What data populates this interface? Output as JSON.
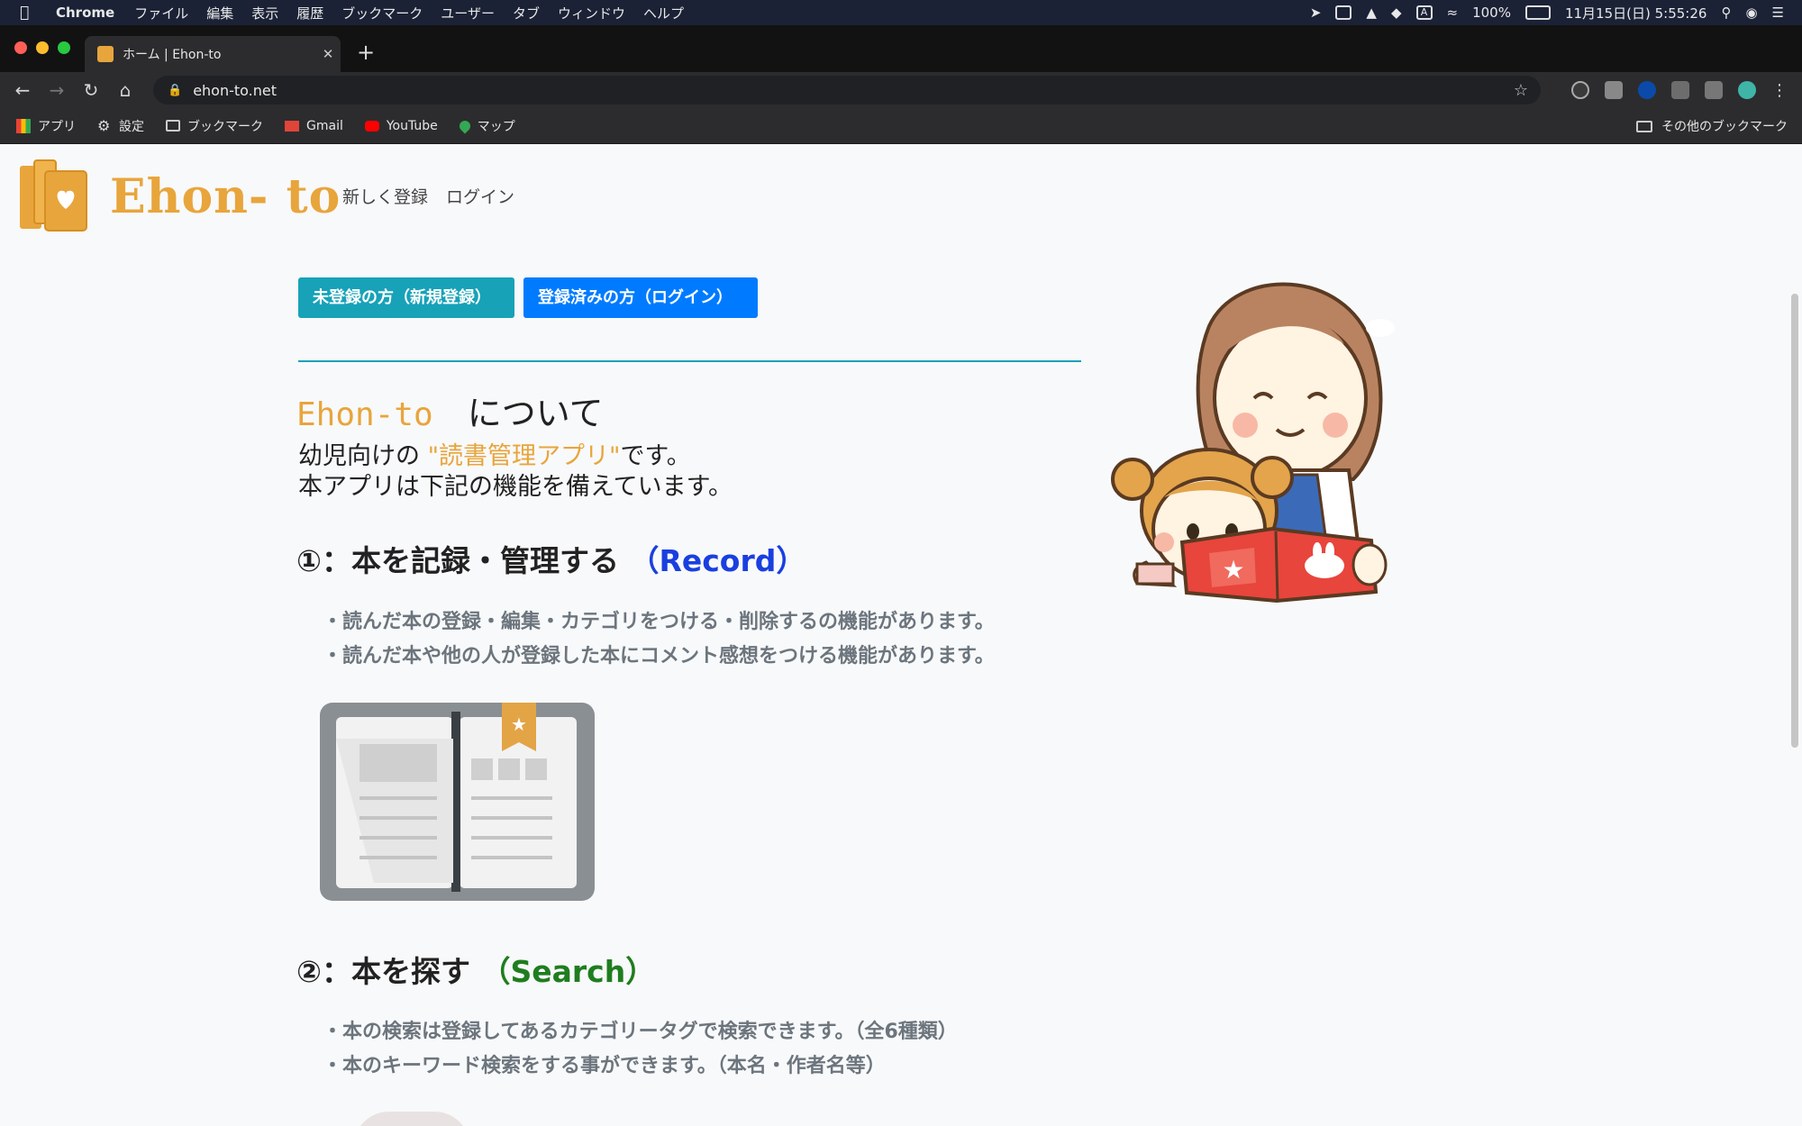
{
  "menubar": {
    "app": "Chrome",
    "items": [
      "ファイル",
      "編集",
      "表示",
      "履歴",
      "ブックマーク",
      "ユーザー",
      "タブ",
      "ウィンドウ",
      "ヘルプ"
    ],
    "battery": "100%",
    "datetime": "11月15日(日)  5:55:26"
  },
  "browser": {
    "tab_title": "ホーム | Ehon-to",
    "url": "ehon-to.net",
    "bookmarks": [
      "アプリ",
      "設定",
      "ブックマーク",
      "Gmail",
      "YouTube",
      "マップ"
    ],
    "other_bookmarks": "その他のブックマーク"
  },
  "header": {
    "logo": "Ehon- to",
    "nav": [
      "新しく登録",
      "ログイン"
    ]
  },
  "buttons": {
    "register": "未登録の方（新規登録）",
    "login": "登録済みの方（ログイン）"
  },
  "about": {
    "brand": "Ehon-to",
    "title_suffix": "について",
    "desc_prefix": "幼児向けの",
    "desc_highlight": "\"読書管理アプリ\"",
    "desc_suffix": "です。",
    "desc_line2": "本アプリは下記の機能を備えています。"
  },
  "sections": [
    {
      "title": "①：本を記録・管理する",
      "en": "（Record）",
      "bullets": [
        "・読んだ本の登録・編集・カテゴリをつける・削除するの機能があります。",
        "・読んだ本や他の人が登録した本にコメント感想をつける機能があります。"
      ]
    },
    {
      "title": "②：本を探す",
      "en": "（Search）",
      "bullets": [
        "・本の検索は登録してあるカテゴリータグで検索できます。（全6種類）",
        "・本のキーワード検索をする事ができます。（本名・作者名等）"
      ]
    }
  ],
  "colors": {
    "brand_orange": "#e8a53c",
    "teal": "#17a2b8",
    "blue": "#007bff",
    "record_blue": "#1a3fe0",
    "search_green": "#1f7d1f"
  }
}
